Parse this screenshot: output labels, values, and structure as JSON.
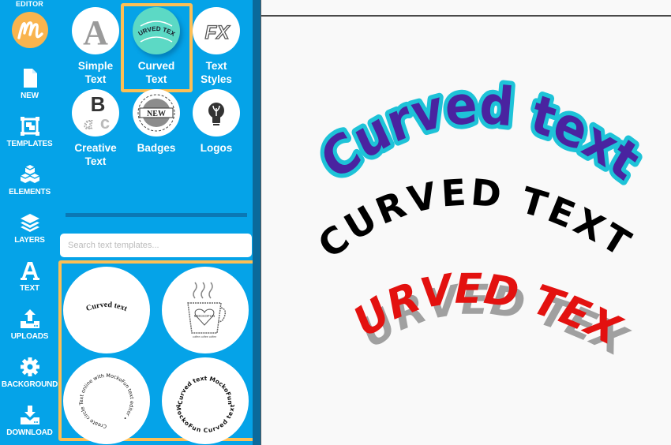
{
  "sidebar": {
    "brand_label": "EDITOR",
    "logo_icon": "mockofun-m-logo",
    "items": [
      {
        "label": "NEW",
        "icon": "new-document-icon"
      },
      {
        "label": "TEMPLATES",
        "icon": "templates-icon"
      },
      {
        "label": "ELEMENTS",
        "icon": "elements-cubes-icon"
      },
      {
        "label": "LAYERS",
        "icon": "layers-icon"
      },
      {
        "label": "TEXT",
        "icon": "text-a-icon"
      },
      {
        "label": "UPLOADS",
        "icon": "upload-icon"
      },
      {
        "label": "BACKGROUND",
        "icon": "gear-icon"
      },
      {
        "label": "DOWNLOAD",
        "icon": "download-icon"
      }
    ]
  },
  "panel": {
    "categories": [
      {
        "label_line1": "Simple",
        "label_line2": "Text",
        "selected": false
      },
      {
        "label_line1": "Curved",
        "label_line2": "Text",
        "selected": true,
        "thumb_text": "CURVED TEXT"
      },
      {
        "label_line1": "Text",
        "label_line2": "Styles",
        "selected": false,
        "thumb_text": "FX"
      },
      {
        "label_line1": "Creative",
        "label_line2": "Text",
        "selected": false,
        "thumb_text": "B"
      },
      {
        "label_line1": "Badges",
        "label_line2": "",
        "selected": false,
        "thumb_text": "NEW"
      },
      {
        "label_line1": "Logos",
        "label_line2": "",
        "selected": false
      }
    ],
    "search": {
      "placeholder": "Search text templates...",
      "value": ""
    },
    "templates": [
      {
        "text": "Curved text"
      },
      {
        "text": "MOCKOFUN",
        "subtext": "coffee coffee coffee"
      },
      {
        "text": "Create circle Text online with MockoFun text editor • "
      },
      {
        "text_top": "Curved text MockoFun",
        "text_bottom": "MockoFun Curved text"
      }
    ]
  },
  "canvas": {
    "texts": [
      {
        "text": "Curved text",
        "fill": "#4a23a0",
        "stroke": "#1ec3d8"
      },
      {
        "text": "CURVED TEXT",
        "fill": "#000000"
      },
      {
        "text": "CURVED TEXT",
        "fill": "#e3110f",
        "shadow": "#a0a0a0"
      }
    ]
  },
  "colors": {
    "sidebar_blue": "#05a3e8",
    "highlight": "#fdbf55",
    "scrollbar": "#0a6a9c",
    "logo_orange": "#f9b44e",
    "curved_thumb": "#5cd9c5"
  }
}
